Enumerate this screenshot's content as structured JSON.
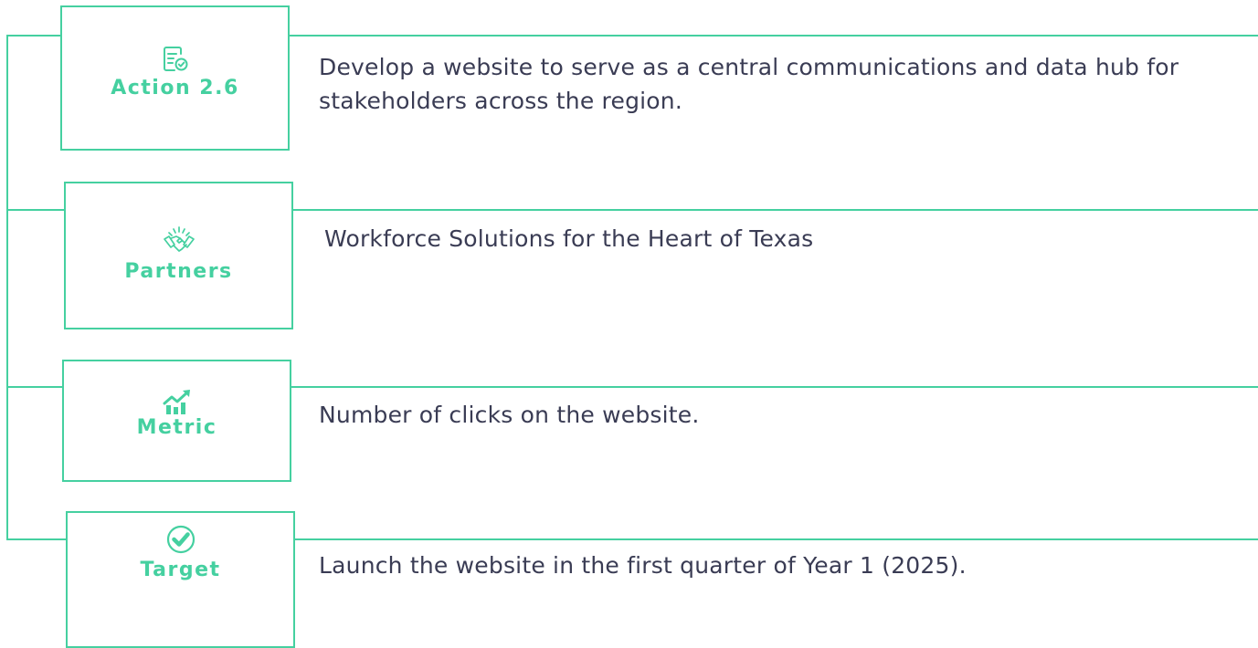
{
  "rows": [
    {
      "label": "Action 2.6",
      "icon": "checklist-icon",
      "text": "Develop a website to serve as a central communications and data hub for stakeholders across the region."
    },
    {
      "label": "Partners",
      "icon": "handshake-icon",
      "text": "Workforce Solutions for the Heart of Texas"
    },
    {
      "label": "Metric",
      "icon": "growth-chart-icon",
      "text": "Number of clicks on the website."
    },
    {
      "label": "Target",
      "icon": "check-circle-icon",
      "text": "Launch the website in the first quarter of Year 1 (2025)."
    }
  ],
  "colors": {
    "accent": "#45d0a0",
    "text": "#3a3c54"
  }
}
